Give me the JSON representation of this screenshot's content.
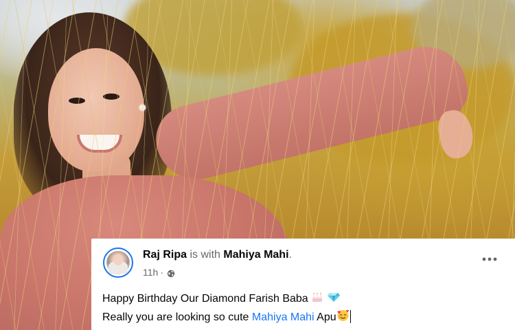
{
  "post": {
    "author": "Raj Ripa",
    "with_text": "is with",
    "tagged_user": "Mahiya Mahi",
    "tagged_suffix": ".",
    "timestamp": "11h",
    "separator": "·",
    "privacy_icon": "globe-icon",
    "more_icon": "more-options-icon",
    "line1_text": "Happy Birthday Our Diamond Farish Baba",
    "line1_emojis": [
      "birthday-cake-emoji",
      "gem-emoji"
    ],
    "line2_prefix": "Really you are looking so cute",
    "line2_mention": "Mahiya Mahi",
    "line2_suffix": "Apu",
    "line2_emoji": "smiling-face-with-hearts-emoji"
  },
  "colors": {
    "mention": "#1877f2",
    "avatar_ring": "#1b74e4",
    "secondary_text": "#65676b",
    "primary_text": "#050505"
  }
}
